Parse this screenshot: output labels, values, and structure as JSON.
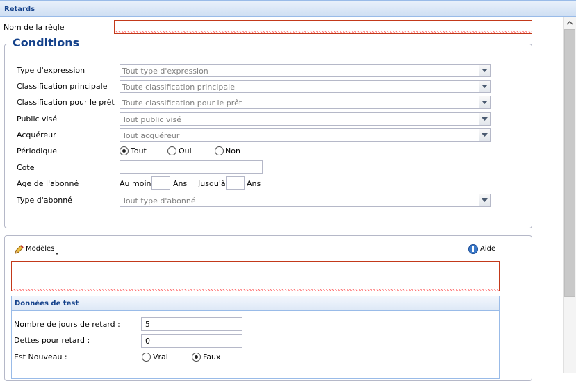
{
  "panel": {
    "title": "Retards"
  },
  "rule": {
    "name_label": "Nom de la règle",
    "name_value": ""
  },
  "conditions": {
    "legend": "Conditions",
    "expression_type": {
      "label": "Type d'expression",
      "value": "Tout type d'expression"
    },
    "main_classification": {
      "label": "Classification principale",
      "value": "Toute classification principale"
    },
    "loan_classification": {
      "label": "Classification pour le prêt",
      "value": "Toute classification pour le prêt"
    },
    "audience": {
      "label": "Public visé",
      "value": "Tout public visé"
    },
    "acquirer": {
      "label": "Acquéreur",
      "value": "Tout acquéreur"
    },
    "periodical": {
      "label": "Périodique",
      "options": [
        "Tout",
        "Oui",
        "Non"
      ],
      "selected": "Tout"
    },
    "call_number": {
      "label": "Cote",
      "value": ""
    },
    "age": {
      "label": "Age de l'abonné",
      "min_label": "Au moins",
      "max_label": "Jusqu'à",
      "unit": "Ans",
      "min_value": "",
      "max_value": ""
    },
    "subscriber_type": {
      "label": "Type d'abonné",
      "value": "Tout type d'abonné"
    }
  },
  "editor": {
    "templates_label": "Modèles",
    "help_label": "Aide",
    "expression_value": ""
  },
  "test_data": {
    "title": "Données de test",
    "days_late": {
      "label": "Nombre de jours de retard :",
      "value": "5"
    },
    "late_debt": {
      "label": "Dettes pour retard :",
      "value": "0"
    },
    "is_new": {
      "label": "Est Nouveau :",
      "options": [
        "Vrai",
        "Faux"
      ],
      "selected": "Faux"
    }
  },
  "colors": {
    "header_text": "#15428b",
    "invalid_border": "#c3391a",
    "field_border": "#b5b8c8"
  }
}
